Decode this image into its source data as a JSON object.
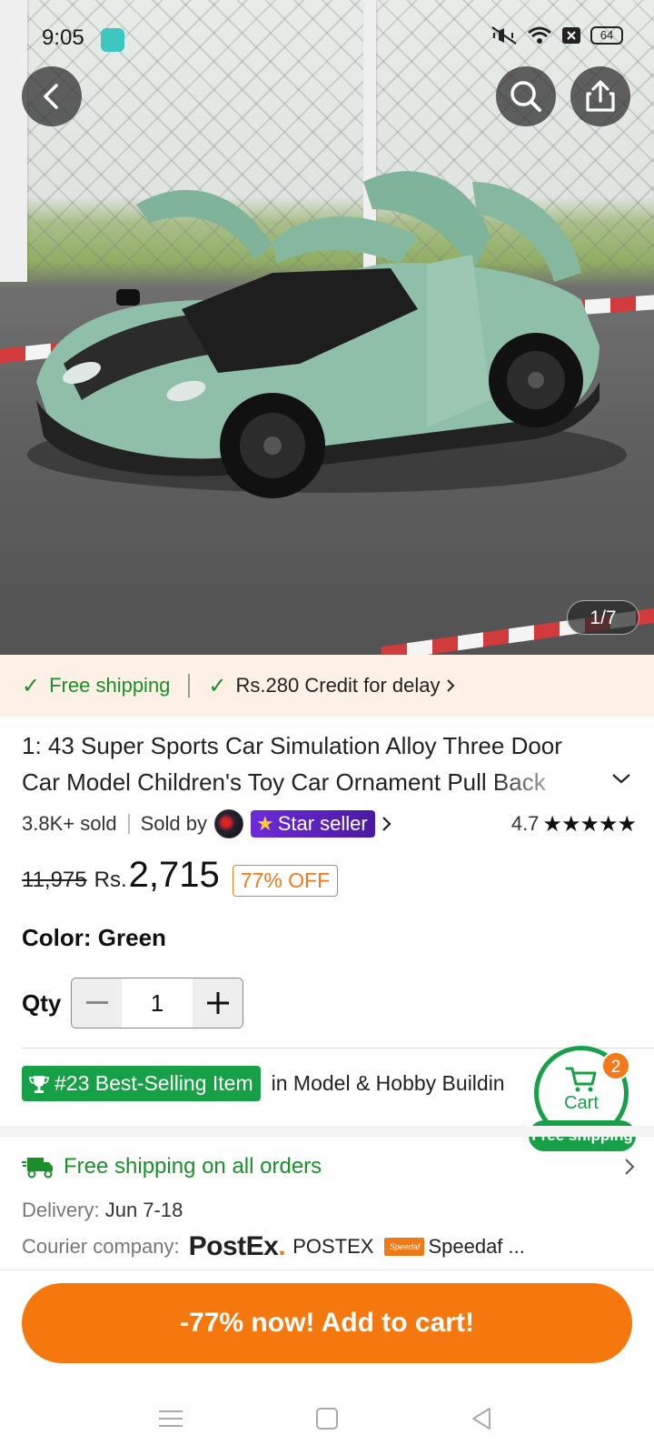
{
  "status_bar": {
    "time": "9:05",
    "battery": "64"
  },
  "hero": {
    "image_counter": "1/7"
  },
  "promo": {
    "free_shipping": "Free shipping",
    "credit": "Rs.280 Credit for delay"
  },
  "product": {
    "title": "1: 43 Super Sports Car Simulation Alloy Three Door Car Model Children's Toy Car Ornament Pull Back",
    "sold": "3.8K+ sold",
    "sold_by_label": "Sold by",
    "star_seller": "Star seller",
    "rating": "4.7",
    "old_price": "11,975",
    "currency": "Rs.",
    "price": "2,715",
    "discount": "77% OFF",
    "color_label": "Color:",
    "color_value": "Green",
    "qty_label": "Qty",
    "qty_value": "1"
  },
  "bestselling": {
    "badge": "#23 Best-Selling Item",
    "category": "in Model & Hobby Buildin"
  },
  "cart": {
    "label": "Cart",
    "count": "2",
    "free_shipping": "Free shipping"
  },
  "shipping": {
    "title": "Free shipping on all orders",
    "delivery_label": "Delivery:",
    "delivery_value": "Jun 7-18",
    "courier_label": "Courier company:",
    "postex_logo": "PostEx",
    "postex_name": "POSTEX",
    "speedaf_logo": "Speedaf",
    "speedaf_name": "Speedaf ..."
  },
  "cta": {
    "label": "-77% now! Add to cart!"
  },
  "colors": {
    "accent": "#f5780f",
    "green": "#17a047",
    "star_seller": "#6d2bd9",
    "promo_bg": "#fdf0e4"
  }
}
